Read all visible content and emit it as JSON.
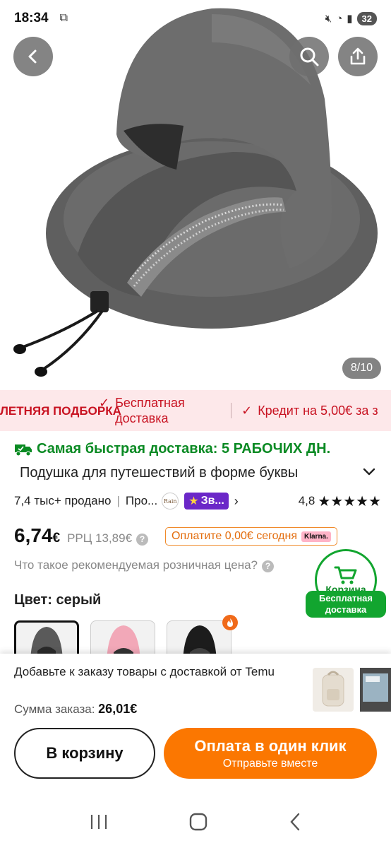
{
  "status_bar": {
    "time": "18:34",
    "battery": "32"
  },
  "hero": {
    "counter": "8/10"
  },
  "promo": {
    "season": "ЛЕТНЯЯ ПОДБОРКА",
    "free_delivery": "Бесплатная доставка",
    "credit": "Кредит на 5,00€ за з"
  },
  "delivery": {
    "fastest": "Самая быстрая доставка: 5 РАБОЧИХ ДН."
  },
  "product": {
    "title": "Подушка для путешествий в форме буквы",
    "sold": "7,4 тыс+ продано",
    "seller_short": "Про...",
    "seller_logo_text": "Rain",
    "star_badge": "Зв...",
    "rating": "4,8",
    "stars": "★★★★★",
    "price_int": "6,74",
    "price_cur": "€",
    "rrp": "РРЦ 13,89€",
    "klarna_text": "Оплатите 0,00€ сегодня",
    "klarna_logo": "Klarna.",
    "rrp_question": "Что такое рекомендуемая розничная цена?",
    "color_label": "Цвет: серый"
  },
  "cart_float": {
    "label": "Корзина",
    "free_shipping": "Бесплатная доставка"
  },
  "sheet": {
    "add_message": "Добавьте к заказу товары с доставкой от Temu",
    "sum_label": "Сумма заказа:",
    "sum_value": "26,01€",
    "add_to_cart": "В корзину",
    "pay_one_click": "Оплата в один клик",
    "pay_sub": "Отправьте вместе"
  },
  "colors": {
    "accent_orange": "#fb7701",
    "promo_red": "#c81221",
    "delivery_green": "#0a8a23",
    "badge_purple": "#6b27c8"
  }
}
